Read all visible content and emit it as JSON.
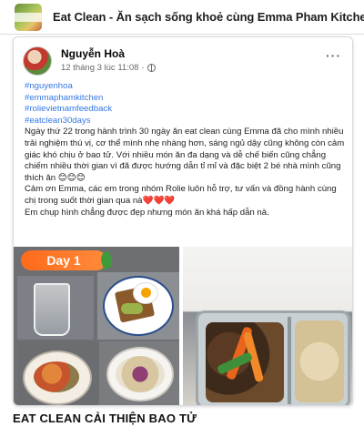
{
  "group": {
    "name": "Eat Clean - Ăn sạch sống khoẻ cùng Emma Pham Kitchen",
    "thumb_icon": "group-cover-image"
  },
  "post": {
    "author": "Nguyễn Hoà",
    "timestamp": "12 tháng 3 lúc 11:08",
    "privacy_icon": "globe-icon",
    "more_icon": "more-options-icon",
    "more_label": "···",
    "hashtags": [
      "#nguyenhoa",
      "#emmaphamkitchen",
      "#rolievietnamfeedback",
      "#eatclean30days"
    ],
    "paragraphs": [
      "Ngày thứ 22 trong hành trình 30 ngày ăn eat clean cùng Emma đã cho mình nhiều trải nghiệm thú vị, cơ thể mình nhẹ nhàng hơn, sáng ngủ dậy cũng không còn cảm giác khó chịu ở bao tử. Với nhiều món ăn đa dạng và dễ chế biến cũng chẳng chiếm nhiều thời gian vì đã được hướng dẫn tỉ mỉ và đặc biệt 2 bé nhà mình cũng thích ăn 😊😊😊",
      "Cảm ơn Emma, các em trong nhóm Rolie luôn hỗ trợ, tư vấn và đồng hành cùng chị trong suốt thời gian qua nà❤️❤️❤️",
      "Em chụp hình chẳng được đẹp nhưng món ăn khá hấp dẫn nà."
    ],
    "photo_left_badge": "Day 1"
  },
  "caption": "EAT CLEAN CẢI THIỆN BAO TỬ",
  "colors": {
    "hashtag": "#3578e5",
    "badge": "#ff6a1a",
    "meta": "#65676b"
  }
}
